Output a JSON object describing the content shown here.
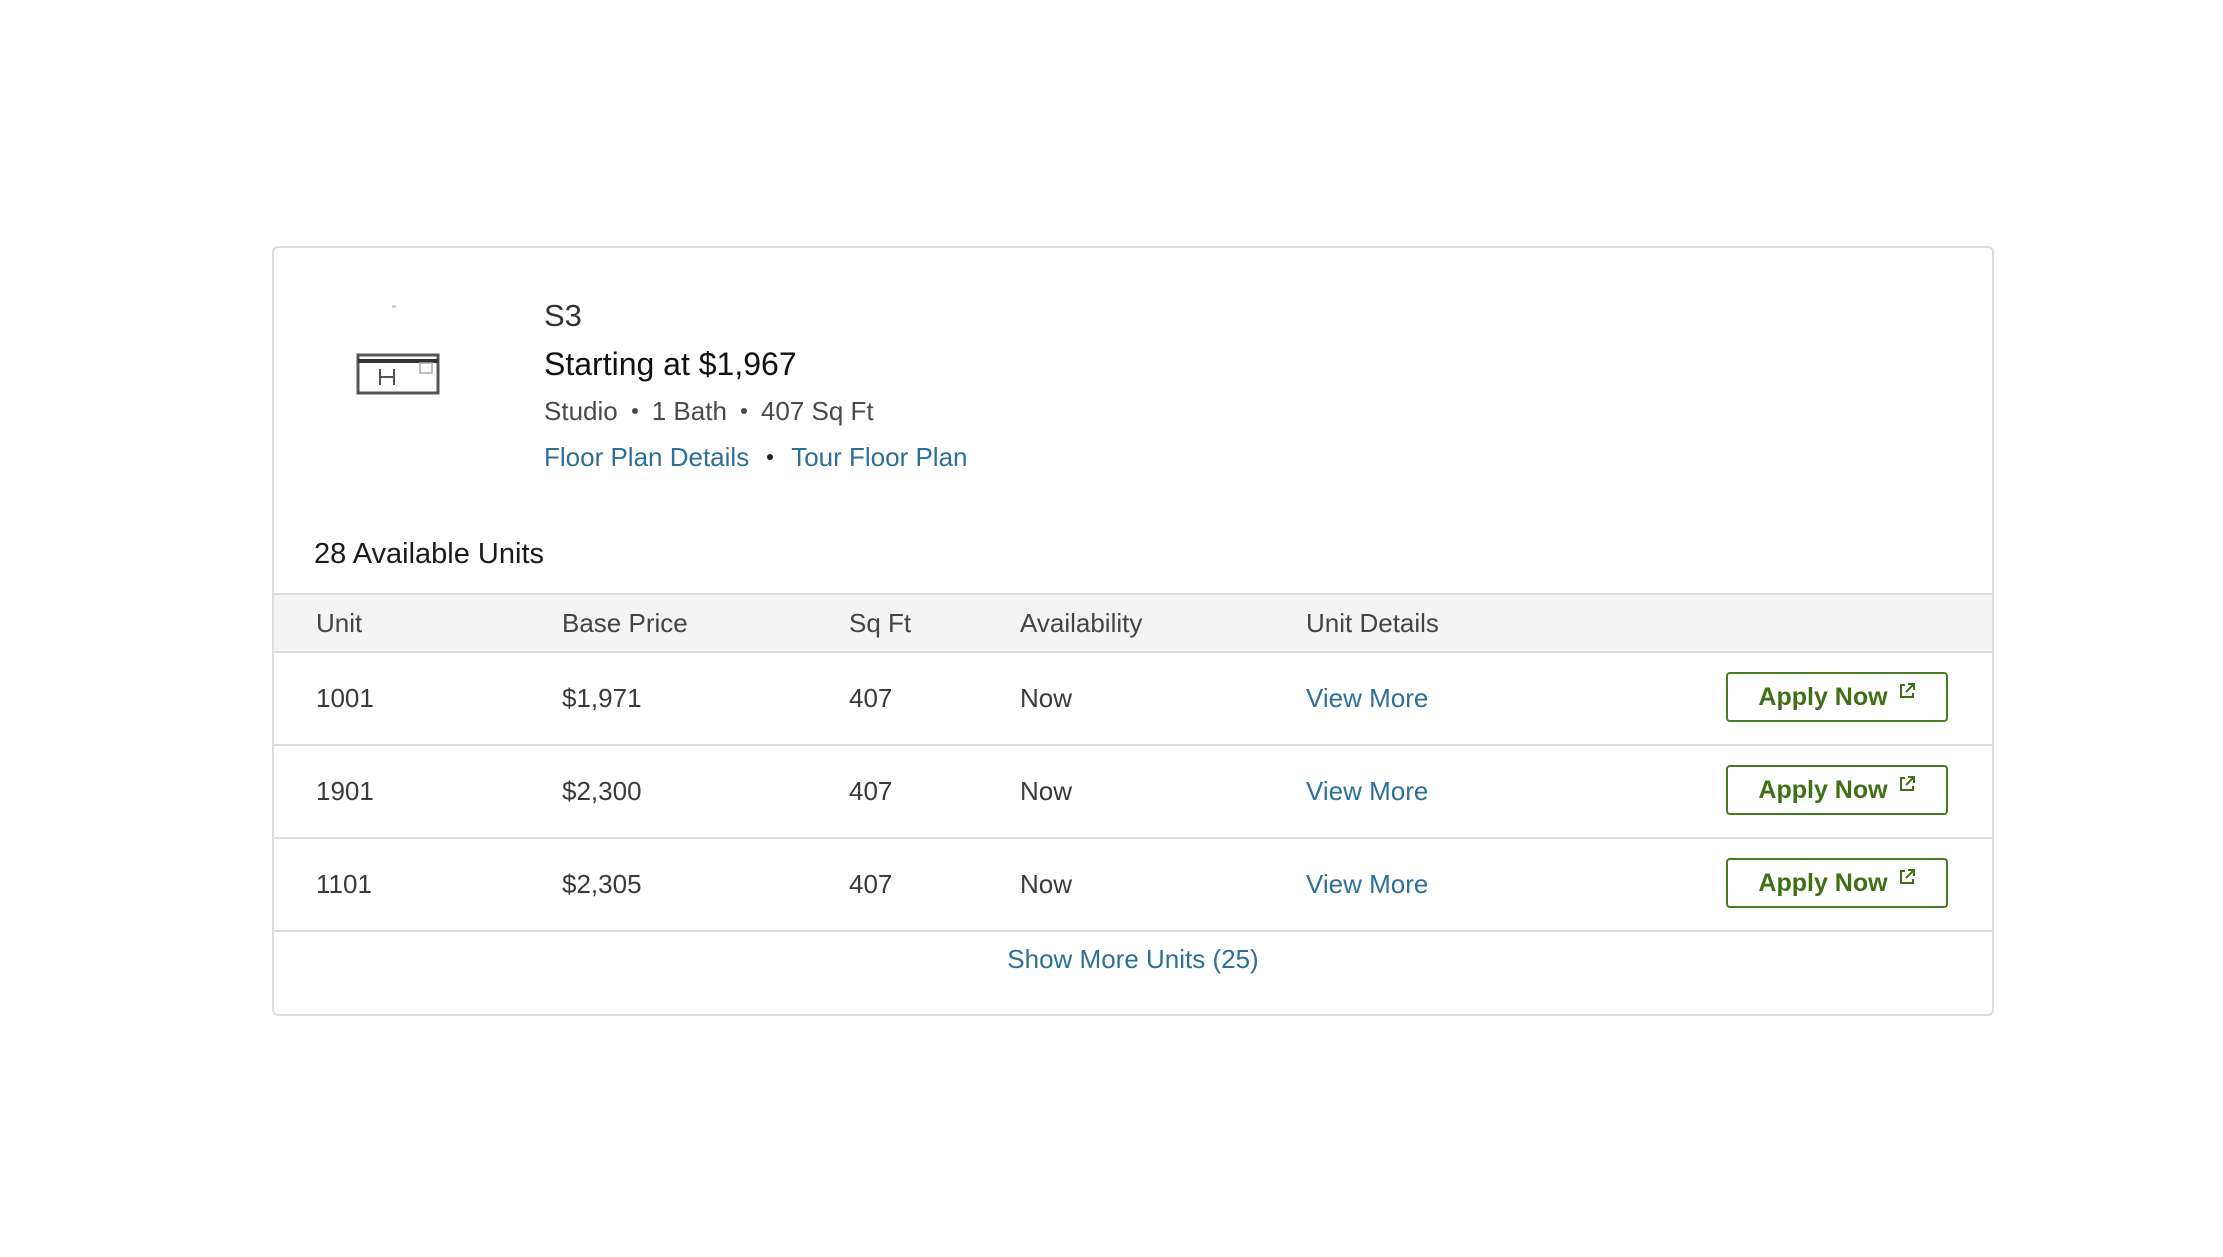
{
  "plan": {
    "name": "S3",
    "price": "Starting at $1,967",
    "specs": [
      "Studio",
      "1 Bath",
      "407 Sq Ft"
    ],
    "links": {
      "floor_plan_details": "Floor Plan Details",
      "tour_floor_plan": "Tour Floor Plan"
    },
    "thumbnail_icon": "floor-plan-icon"
  },
  "units": {
    "available_count": "28 Available Units",
    "columns": [
      "Unit",
      "Base Price",
      "Sq Ft",
      "Availability",
      "Unit Details"
    ],
    "rows": [
      {
        "unit": "1001",
        "price": "$1,971",
        "sqft": "407",
        "availability": "Now",
        "details": "View More",
        "apply": "Apply Now"
      },
      {
        "unit": "1901",
        "price": "$2,300",
        "sqft": "407",
        "availability": "Now",
        "details": "View More",
        "apply": "Apply Now"
      },
      {
        "unit": "1101",
        "price": "$2,305",
        "sqft": "407",
        "availability": "Now",
        "details": "View More",
        "apply": "Apply Now"
      }
    ],
    "show_more": "Show More Units (25)"
  },
  "colors": {
    "link": "#2e6f98",
    "apply_border": "#4a7c1f",
    "apply_text": "#3f7016",
    "header_bg": "#f4f4f4",
    "border": "#dcdcdc"
  }
}
